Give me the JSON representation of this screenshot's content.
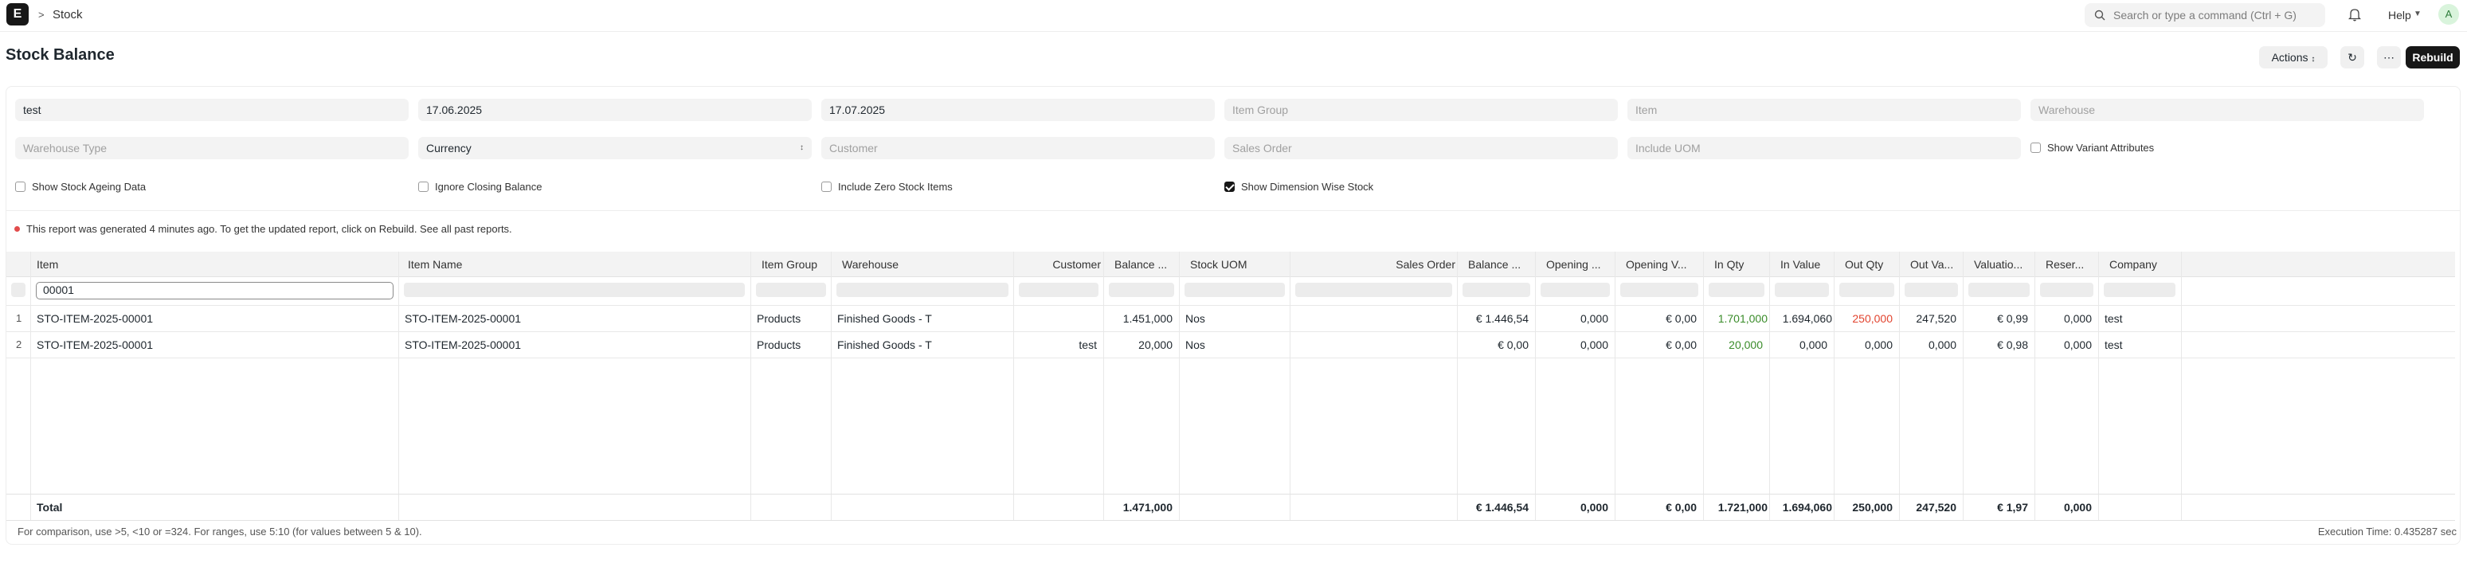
{
  "navbar": {
    "logo_letter": "E",
    "breadcrumb_sep": ">",
    "breadcrumb": "Stock",
    "search_placeholder": "Search or type a command (Ctrl + G)",
    "help_label": "Help",
    "avatar_letter": "A"
  },
  "page": {
    "title": "Stock Balance",
    "actions_label": "Actions",
    "rebuild_label": "Rebuild"
  },
  "filters": {
    "company": "test",
    "from_date": "17.06.2025",
    "to_date": "17.07.2025",
    "item_group_placeholder": "Item Group",
    "item_placeholder": "Item",
    "warehouse_placeholder": "Warehouse",
    "warehouse_type_placeholder": "Warehouse Type",
    "currency": "Currency",
    "customer_placeholder": "Customer",
    "sales_order_placeholder": "Sales Order",
    "include_uom_placeholder": "Include UOM",
    "show_variant_attributes": "Show Variant Attributes",
    "show_stock_ageing": "Show Stock Ageing Data",
    "ignore_closing_balance": "Ignore Closing Balance",
    "include_zero_stock": "Include Zero Stock Items",
    "show_dimension_wise": "Show Dimension Wise Stock",
    "show_dimension_wise_checked": true
  },
  "message": "This report was generated 4 minutes ago. To get the updated report, click on Rebuild. See all past reports.",
  "table": {
    "columns": [
      "Item",
      "Item Name",
      "Item Group",
      "Warehouse",
      "Customer",
      "Balance ...",
      "Stock UOM",
      "Sales Order",
      "Balance ...",
      "Opening ...",
      "Opening V...",
      "In Qty",
      "In Value",
      "Out Qty",
      "Out Va...",
      "Valuatio...",
      "Reser...",
      "Company"
    ],
    "item_filter_value": "00001",
    "rows": [
      {
        "num": "1",
        "item": "STO-ITEM-2025-00001",
        "item_name": "STO-ITEM-2025-00001",
        "item_group": "Products",
        "warehouse": "Finished Goods - T",
        "customer": "",
        "bal_qty": "1.451,000",
        "uom": "Nos",
        "sales_order": "",
        "bal_val": "€ 1.446,54",
        "open_qty": "0,000",
        "open_val": "€ 0,00",
        "in_qty": "1.701,000",
        "in_val": "1.694,060",
        "out_qty": "250,000",
        "out_val": "247,520",
        "val_rate": "€ 0,99",
        "reserved": "0,000",
        "company": "test"
      },
      {
        "num": "2",
        "item": "STO-ITEM-2025-00001",
        "item_name": "STO-ITEM-2025-00001",
        "item_group": "Products",
        "warehouse": "Finished Goods - T",
        "customer": "test",
        "bal_qty": "20,000",
        "uom": "Nos",
        "sales_order": "",
        "bal_val": "€ 0,00",
        "open_qty": "0,000",
        "open_val": "€ 0,00",
        "in_qty": "20,000",
        "in_val": "0,000",
        "out_qty": "0,000",
        "out_val": "0,000",
        "val_rate": "€ 0,98",
        "reserved": "0,000",
        "company": "test"
      }
    ],
    "total": {
      "label": "Total",
      "bal_qty": "1.471,000",
      "bal_val": "€ 1.446,54",
      "open_qty": "0,000",
      "open_val": "€ 0,00",
      "in_qty": "1.721,000",
      "in_val": "1.694,060",
      "out_qty": "250,000",
      "out_val": "247,520",
      "val_rate": "€ 1,97",
      "reserved": "0,000"
    }
  },
  "footer": {
    "hint": "For comparison, use >5, <10 or =324. For ranges, use 5:10 (for values between 5 & 10).",
    "execution_time": "Execution Time: 0.435287 sec"
  },
  "colors": {
    "positive": "#3a8c2a",
    "negative": "#e2442f",
    "primary": "#171717"
  }
}
